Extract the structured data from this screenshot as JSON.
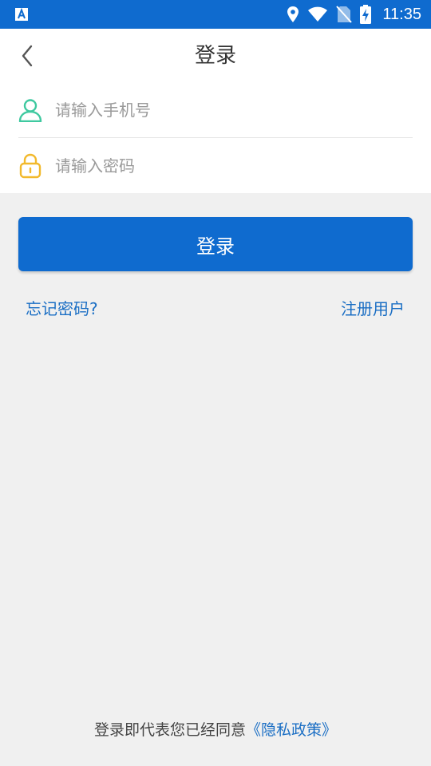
{
  "status_bar": {
    "time": "11:35",
    "background": "#0f6bcf",
    "icons": [
      "app-a-icon",
      "location-icon",
      "wifi-icon",
      "no-sim-icon",
      "battery-charging-icon"
    ]
  },
  "header": {
    "title": "登录",
    "back_icon": "chevron-left-icon"
  },
  "form": {
    "phone": {
      "placeholder": "请输入手机号",
      "value": "",
      "icon": "user-icon",
      "icon_color": "#3fc9a0"
    },
    "password": {
      "placeholder": "请输入密码",
      "value": "",
      "icon": "lock-icon",
      "icon_color": "#f2b92c"
    }
  },
  "actions": {
    "login_label": "登录",
    "forgot_label": "忘记密码?",
    "register_label": "注册用户",
    "accent": "#0f6bcf",
    "link_color": "#1a6ec4"
  },
  "footer": {
    "agreement_text": "登录即代表您已经同意",
    "policy_link": "《隐私政策》"
  }
}
